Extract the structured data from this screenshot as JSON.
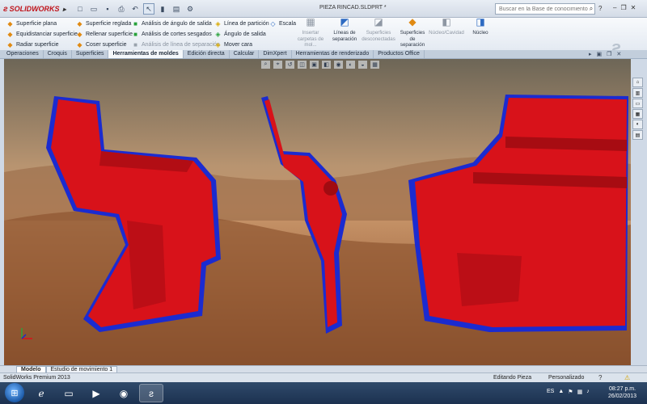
{
  "app": {
    "brand": "SOLIDWORKS",
    "document_title": "PIEZA RINCAD.SLDPRT *"
  },
  "search": {
    "placeholder": "Buscar en la Base de conocimiento"
  },
  "ribbon": {
    "col1": [
      "Superficie plana",
      "Equidistanciar superficie",
      "Radiar superficie"
    ],
    "col2": [
      "Superficie reglada",
      "Rellenar superficie",
      "Coser superficie"
    ],
    "col3": [
      "Análisis de ángulo de salida",
      "Análisis de cortes sesgados",
      "Análisis de línea de separación"
    ],
    "col4": [
      "Línea de partición",
      "Ángulo de salida",
      "Mover cara"
    ],
    "col5": [
      "Escala"
    ],
    "big": [
      "Insertar carpetas de mol...",
      "Líneas de separación",
      "Superficies desconectadas",
      "Superficies de separación",
      "Núcleo/Cavidad",
      "Núcleo"
    ]
  },
  "tabs": [
    "Operaciones",
    "Croquis",
    "Superficies",
    "Herramientas de moldes",
    "Edición directa",
    "Calcular",
    "DimXpert",
    "Herramientas de renderizado",
    "Productos Office"
  ],
  "model_tabs": [
    "Modelo",
    "Estudio de movimiento 1"
  ],
  "status": {
    "product": "SolidWorks Premium 2013",
    "mode": "Editando Pieza",
    "units": "Personalizado"
  },
  "taskbar": {
    "language": "ES",
    "time": "08:27 p.m.",
    "date": "26/02/2013"
  },
  "colors": {
    "part_red": "#d8121a",
    "parting_blue": "#1b2bd0",
    "accent": "#2e6bc2"
  }
}
